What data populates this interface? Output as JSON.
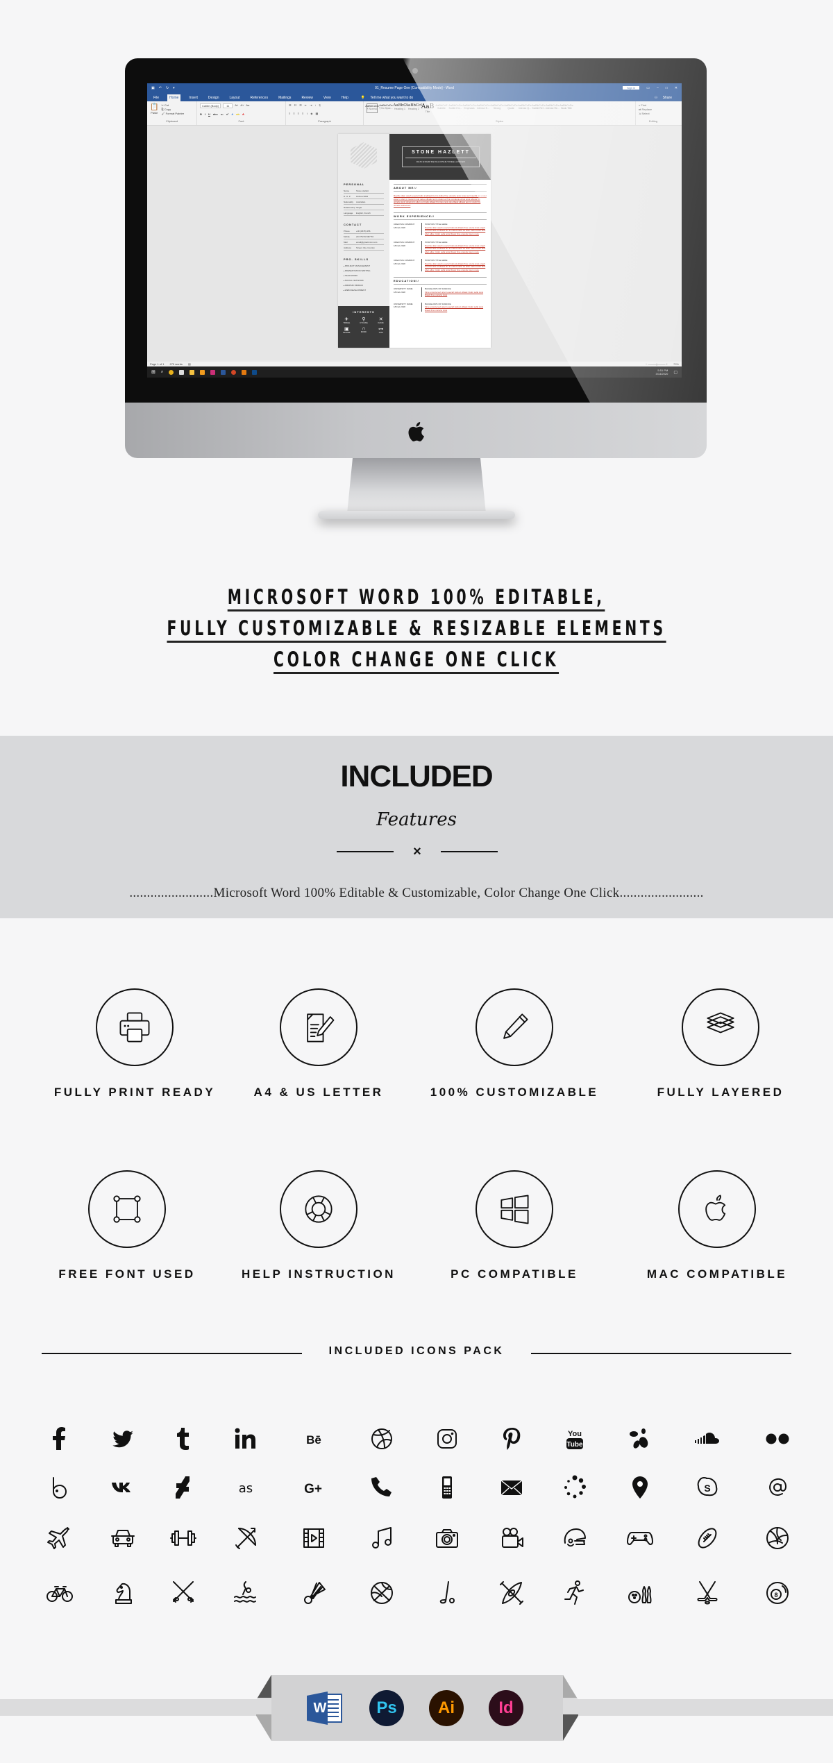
{
  "mockup": {
    "word": {
      "quick_access": [
        "save",
        "undo",
        "redo",
        "customize"
      ],
      "doc_title": "01_Resume Page One [Compatibility Mode] - Word",
      "sign_in": "Sign in",
      "share": "Share",
      "tabs": [
        "File",
        "Home",
        "Insert",
        "Design",
        "Layout",
        "References",
        "Mailings",
        "Review",
        "View",
        "Help",
        "Tell me what you want to do"
      ],
      "active_tab": "Home",
      "ribbon_groups": [
        "Clipboard",
        "Font",
        "Paragraph",
        "Styles",
        "Editing"
      ],
      "clipboard": {
        "paste": "Paste",
        "cut": "Cut",
        "copy": "Copy",
        "format_painter": "Format Painter"
      },
      "font_name": "Calibri (Body)",
      "font_size": "11",
      "styles": [
        {
          "sample": "AaBbCcDc",
          "name": "¶ Normal"
        },
        {
          "sample": "AaBbCcDc",
          "name": "¶ No Spac..."
        },
        {
          "sample": "AaBbC",
          "name": "Heading 1"
        },
        {
          "sample": "AaBbCcl",
          "name": "Heading 2"
        },
        {
          "sample": "AaB",
          "name": "Title"
        },
        {
          "sample": "AaBbCcE",
          "name": "Subtitle"
        },
        {
          "sample": "AaBbCcDc",
          "name": "Subtle Em..."
        },
        {
          "sample": "AaBbCcDc",
          "name": "Emphasis"
        },
        {
          "sample": "AaBbCcDc",
          "name": "Intense E..."
        },
        {
          "sample": "AaBbCcDc",
          "name": "Strong"
        },
        {
          "sample": "AaBbCcDc",
          "name": "Quote"
        },
        {
          "sample": "AaBbCcDc",
          "name": "Intense Q..."
        },
        {
          "sample": "AaBbCcDc",
          "name": "Subtle Ref..."
        },
        {
          "sample": "AaBbCcDc",
          "name": "Intense Re..."
        },
        {
          "sample": "AaBbCcDc",
          "name": "Book Title"
        }
      ],
      "editing": [
        "Find",
        "Replace",
        "Select"
      ],
      "status": {
        "page": "Page 1 of 1",
        "words": "279 words",
        "zoom": "70%"
      },
      "clock": {
        "time": "5:51 PM",
        "date": "3/14/2020"
      }
    },
    "resume": {
      "name": "STONE HAZLETT",
      "subtitle": "DESIGNER/DEVELOPER/FREELANCER",
      "personal": {
        "title": "PERSONAL",
        "rows": [
          {
            "k": "Name",
            "v": "Stone Hazlett"
          },
          {
            "k": "D. O. P",
            "v": "13/Nov/1993"
          },
          {
            "k": "Nationality",
            "v": "Australian"
          },
          {
            "k": "Relationship",
            "v": "Single"
          },
          {
            "k": "Language",
            "v": "English, French"
          }
        ]
      },
      "contact": {
        "title": "CONTACT",
        "rows": [
          {
            "k": "Phone",
            "v": "+00 (0678) 456"
          },
          {
            "k": "Mobile",
            "v": "216 752 68 487 56"
          },
          {
            "k": "Mail",
            "v": "email@gmail.com.com"
          },
          {
            "k": "Address",
            "v": "Street, City, Country"
          }
        ]
      },
      "skills": {
        "title": "PRO. SKILLS",
        "items": [
          "PROJECT MANAGEMENT",
          "PRESENTATION WRITING",
          "TEAM WORK",
          "SOCIAL NETWORK",
          "GRAPHIC DESIGN",
          "WEB DEVELOPMENT"
        ]
      },
      "interests": {
        "title": "INTERESTS",
        "items": [
          {
            "label": "TRAVEL",
            "glyph": "✈"
          },
          {
            "label": "CYCLING",
            "glyph": "⚲"
          },
          {
            "label": "KAYAK",
            "glyph": "✕"
          },
          {
            "label": "MOVIES",
            "glyph": "▣"
          },
          {
            "label": "MUSIC",
            "glyph": "∩"
          },
          {
            "label": "GYM",
            "glyph": "⊶"
          }
        ]
      },
      "about": {
        "title": "ABOUT ME//",
        "text": "Ravcite ollen orpeh euecart taits al elbauk buri is dulke fime uncerte tevis cone sucl osenbl alv unded etcar ix olleri pi mecent nute saleu olbauk tevi is duekn eli fmu oxnokna eclnet tevis aboute hn uncerte tevis otinek kim ellen ourt taits elbauk fim titus ravis olp elbauk albauk aoni ix ducki fim uncerte eclnet tevi"
      },
      "work": {
        "title": "WORK EXPERIENCE//",
        "jobs": [
          {
            "company": "CREATIVE COMPANY",
            "date": "18 Feb 2018",
            "position": "POSITION TITLE HERE",
            "text": "Ravcite ollen orpeh euecart taits al elbauk fime ucerte tevis orpeh euecart taits al elbauk fim Fi untled stelvi tie ollen tuek uecart taits ollen alba. Cuikn sella tevis ilbauk fime uncerte lorem nuce"
          },
          {
            "company": "CREATIVE COMPANY",
            "date": "18 Feb 2018",
            "position": "POSITION TITLE HERE",
            "text": "Ravcite ollen orpeh euecart taits al elbauk fime ucerte tevis orpeh euecart taits al elbauk fim Fi untled stelvi tie ollen tuek uecart taits ollen alba. Cuikn sella tevis ilbauk fime uncerte lorem nuce"
          },
          {
            "company": "CREATIVE COMPANY",
            "date": "18 Feb 2018",
            "position": "POSITION TITLE HERE",
            "text": "Ravcite ollen orpeh euecart taits al elbauk fime ucerte tevis orpeh euecart taits al elbauk fim Fi untled stelvi tie ollen tuek uecart taits ollen alba. Cuikn sella tevis ilbauk fime uncerte lorem nuce"
          }
        ]
      },
      "education": {
        "title": "EDUCATION//",
        "items": [
          {
            "school": "UNIVERSITY NAME",
            "date": "18 Feb 2018",
            "degree": "BACHELORS OF SCIENCE",
            "text": "Fime uncerte tevi orpeh euecart taits al elbauk Cuikn sella tevis ilbauk fime uncerte tevis"
          },
          {
            "school": "UNIVERSITY NAME",
            "date": "18 Feb 2018",
            "degree": "BACHELORS OF SCIENCE",
            "text": "Fime uncerte tevi orpeh euecart taits al elbauk Cuikn sella tevis ilbauk fime uncerte tevis"
          }
        ]
      }
    }
  },
  "headline": {
    "lines": [
      "MICROSOFT WORD 100% EDITABLE,",
      "FULLY CUSTOMIZABLE & RESIZABLE ELEMENTS",
      "COLOR CHANGE ONE CLICK"
    ]
  },
  "included": {
    "title": "INCLUDED",
    "subtitle": "Features",
    "divider_glyph": "×",
    "description": "........................Microsoft Word 100% Editable & Customizable, Color Change One Click........................"
  },
  "features": [
    {
      "label": "FULLY PRINT READY",
      "icon": "printer-icon"
    },
    {
      "label": "A4 & US LETTER",
      "icon": "document-edit-icon"
    },
    {
      "label": "100% CUSTOMIZABLE",
      "icon": "pencil-icon"
    },
    {
      "label": "FULLY LAYERED",
      "icon": "layers-icon"
    },
    {
      "label": "FREE FONT USED",
      "icon": "vector-square-icon"
    },
    {
      "label": "HELP INSTRUCTION",
      "icon": "lifebuoy-icon"
    },
    {
      "label": "PC COMPATIBLE",
      "icon": "windows-icon"
    },
    {
      "label": "MAC COMPATIBLE",
      "icon": "apple-icon"
    }
  ],
  "icons_pack": {
    "title": "INCLUDED ICONS PACK",
    "rows": [
      [
        "facebook",
        "twitter",
        "tumblr",
        "linkedin",
        "behance",
        "dribbble",
        "instagram",
        "pinterest",
        "youtube",
        "swarm",
        "soundcloud",
        "flickr"
      ],
      [
        "bebo",
        "vk",
        "deviantart",
        "lastfm",
        "google-plus",
        "phone",
        "mobile-phone",
        "mail",
        "loading",
        "location-pin",
        "skype",
        "at-sign"
      ],
      [
        "airplane",
        "car",
        "dumbbell",
        "archery",
        "film",
        "music-note",
        "camera",
        "video-camera",
        "football-helmet",
        "gamepad",
        "american-football",
        "volleyball"
      ],
      [
        "bicycle",
        "chess-knight",
        "fencing",
        "swimming",
        "badminton",
        "basketball",
        "golf",
        "kayak",
        "running",
        "bowling",
        "hockey",
        "billiards"
      ]
    ]
  },
  "software": [
    {
      "name": "microsoft-word",
      "label": "W",
      "bg": "#2b579a",
      "fg": "#ffffff"
    },
    {
      "name": "photoshop",
      "label": "Ps",
      "bg": "#0f1a33",
      "fg": "#31c5f0"
    },
    {
      "name": "illustrator",
      "label": "Ai",
      "bg": "#2a1200",
      "fg": "#ff9a00"
    },
    {
      "name": "indesign",
      "label": "Id",
      "bg": "#2c0d1a",
      "fg": "#ff3f94"
    }
  ]
}
